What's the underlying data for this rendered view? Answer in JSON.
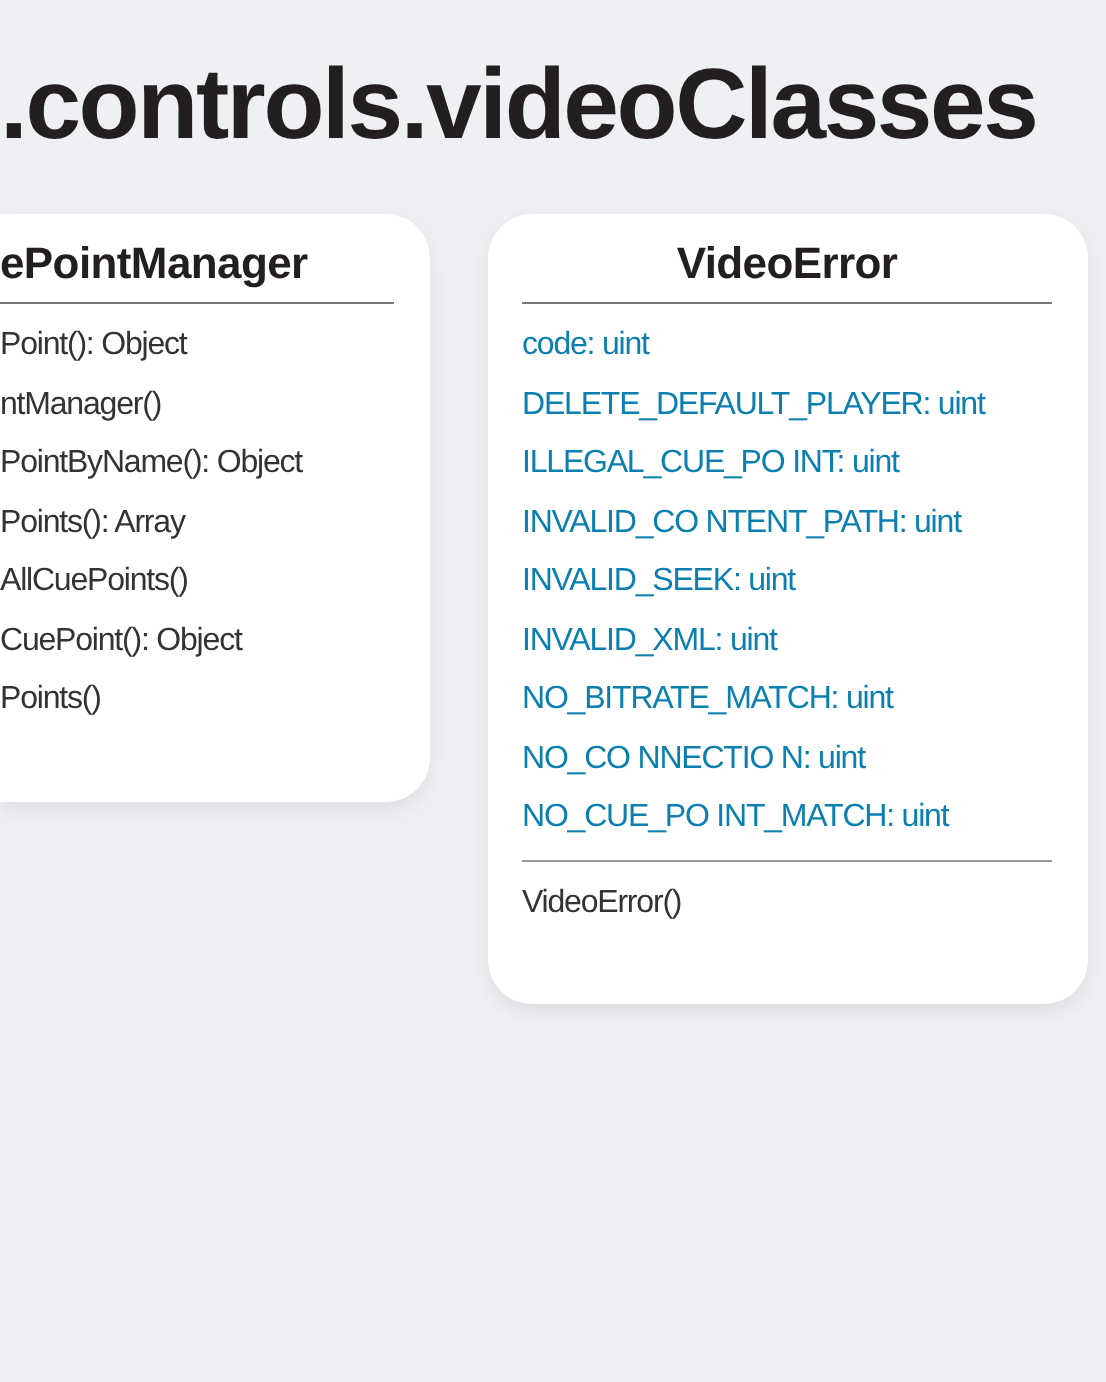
{
  "title": ".controls.videoClasses",
  "classes": [
    {
      "name": "ePointManager",
      "methods": [
        "Point(): Object",
        "ntManager()",
        "PointByName(): Object",
        "Points(): Array",
        "AllCuePoints()",
        "CuePoint(): Object",
        "Points()"
      ]
    },
    {
      "name": "VideoError",
      "attributes": [
        "code: uint",
        "DELETE_DEFAULT_PLAYER: uint",
        "ILLEGAL_CUE_PO INT: uint",
        "INVALID_CO NTENT_PATH: uint",
        "INVALID_SEEK: uint",
        "INVALID_XML: uint",
        "NO_BITRATE_MATCH: uint",
        "NO_CO NNECTIO N: uint",
        "NO_CUE_PO INT_MATCH: uint"
      ],
      "methods": [
        "VideoError()"
      ]
    }
  ]
}
